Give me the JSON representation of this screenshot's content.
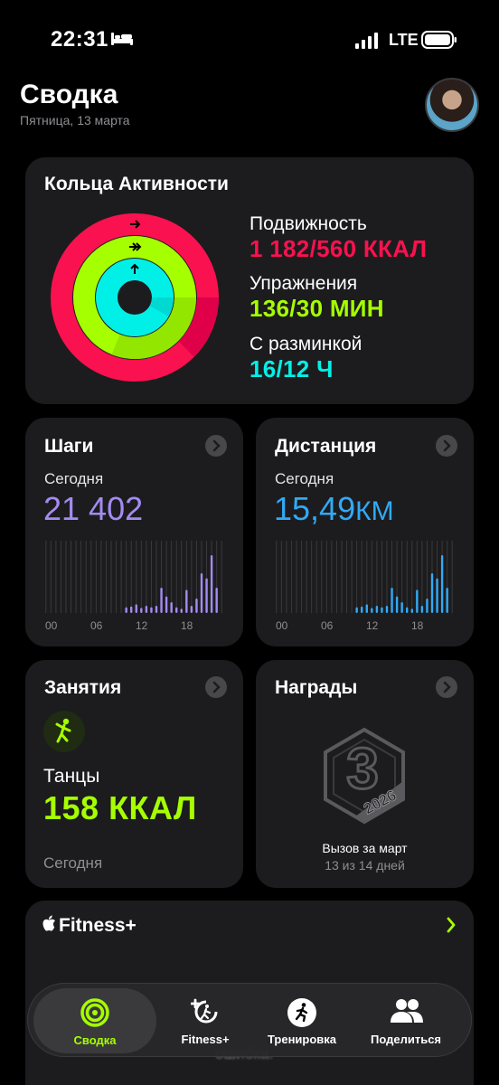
{
  "status_bar": {
    "time": "22:31",
    "network": "LTE"
  },
  "header": {
    "title": "Сводка",
    "date": "Пятница, 13 марта"
  },
  "activity": {
    "title": "Кольца Активности",
    "move_label": "Подвижность",
    "move_value": "1 182/560 ККАЛ",
    "exercise_label": "Упражнения",
    "exercise_value": "136/30 МИН",
    "stand_label": "С разминкой",
    "stand_value": "16/12 Ч",
    "colors": {
      "move": "#fa114f",
      "exercise": "#a6ff00",
      "stand": "#00f0e8"
    }
  },
  "steps": {
    "title": "Шаги",
    "period": "Сегодня",
    "value": "21 402",
    "color": "#a48bf2",
    "axis_labels": [
      "00",
      "06",
      "12",
      "18"
    ],
    "hourly": [
      0,
      0,
      0,
      0,
      0,
      0,
      0,
      0,
      0,
      0,
      0,
      0,
      0,
      0,
      0,
      0,
      0.08,
      0.09,
      0.12,
      0.07,
      0.1,
      0.08,
      0.1,
      0.35,
      0.23,
      0.15,
      0.08,
      0.06,
      0.32,
      0.1,
      0.2,
      0.55,
      0.48,
      0.8,
      0.35,
      0
    ]
  },
  "distance": {
    "title": "Дистанция",
    "period": "Сегодня",
    "value_number": "15,49",
    "value_unit": "КМ",
    "color": "#32a9f5",
    "axis_labels": [
      "00",
      "06",
      "12",
      "18"
    ],
    "hourly": [
      0,
      0,
      0,
      0,
      0,
      0,
      0,
      0,
      0,
      0,
      0,
      0,
      0,
      0,
      0,
      0,
      0.08,
      0.09,
      0.12,
      0.07,
      0.1,
      0.08,
      0.1,
      0.35,
      0.23,
      0.15,
      0.08,
      0.06,
      0.32,
      0.1,
      0.2,
      0.55,
      0.48,
      0.8,
      0.35,
      0
    ]
  },
  "workouts": {
    "title": "Занятия",
    "type": "Танцы",
    "value": "158 ККАЛ",
    "period": "Сегодня",
    "icon": "dance-icon"
  },
  "awards": {
    "title": "Награды",
    "badge_title": "Вызов за март",
    "badge_subtitle": "13 из 14 дней",
    "badge_number": "3",
    "badge_year": "2026"
  },
  "fitness_plus": {
    "title": "Fitness+",
    "partial_text": "ошибка."
  },
  "tabs": [
    {
      "label": "Сводка",
      "icon": "summary-rings-icon",
      "active": true
    },
    {
      "label": "Fitness+",
      "icon": "fitness-plus-icon",
      "active": false
    },
    {
      "label": "Тренировка",
      "icon": "workout-runner-icon",
      "active": false
    },
    {
      "label": "Поделиться",
      "icon": "share-people-icon",
      "active": false
    }
  ]
}
